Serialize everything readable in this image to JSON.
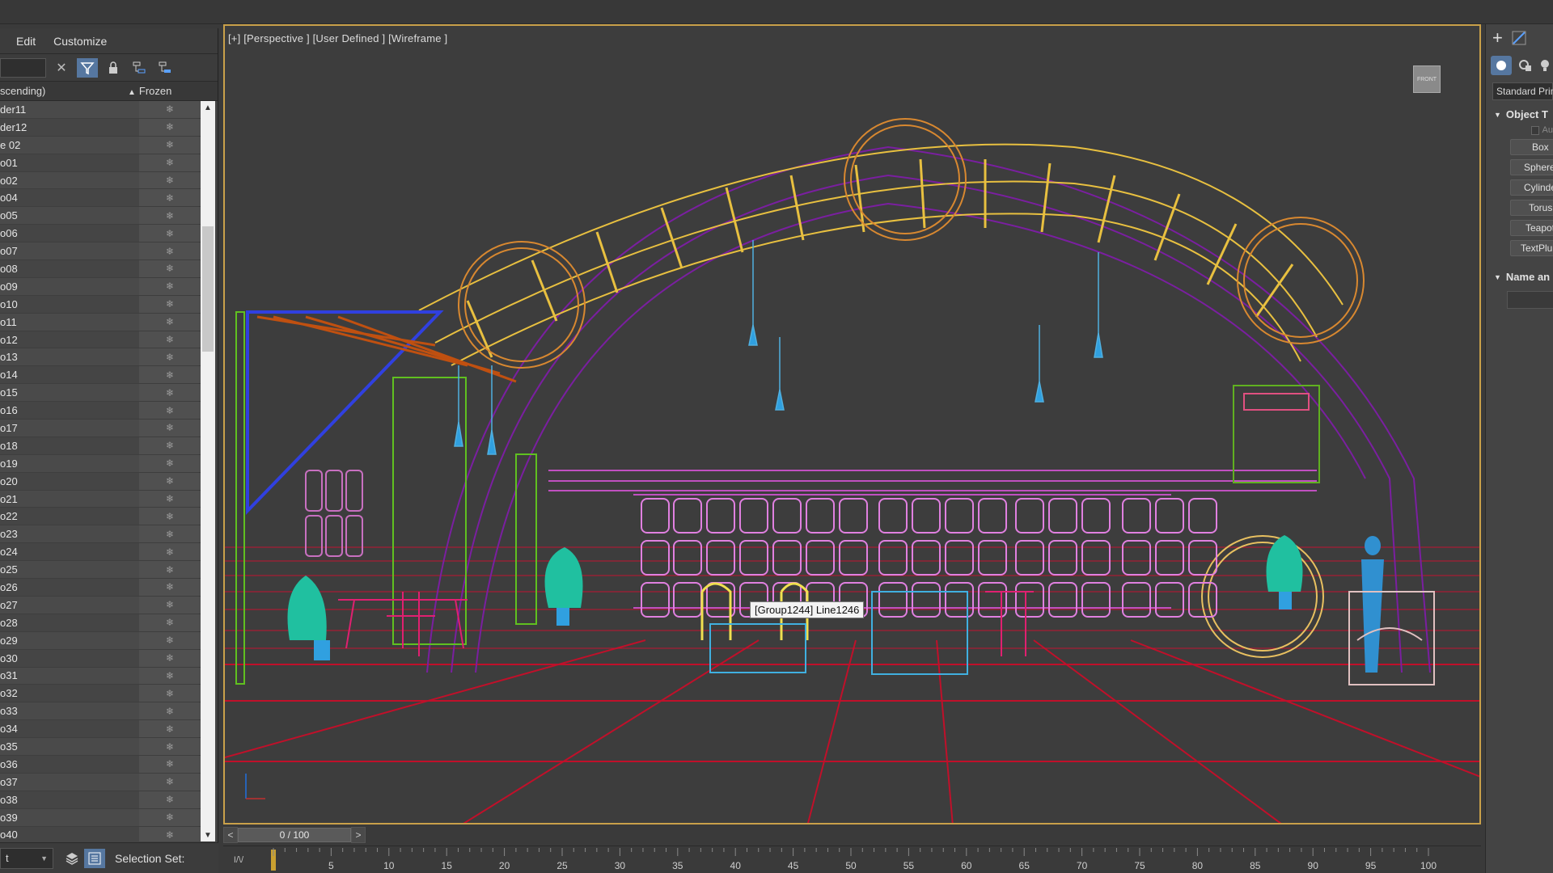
{
  "explorer": {
    "menu": [
      "Edit",
      "Customize"
    ],
    "header": {
      "name_col": "scending)",
      "sort_indicator": "▲",
      "frozen_col": "Frozen"
    },
    "rows": [
      "der11",
      "der12",
      "e 02",
      "o01",
      "o02",
      "o04",
      "o05",
      "o06",
      "o07",
      "o08",
      "o09",
      "o10",
      "o11",
      "o12",
      "o13",
      "o14",
      "o15",
      "o16",
      "o17",
      "o18",
      "o19",
      "o20",
      "o21",
      "o22",
      "o23",
      "o24",
      "o25",
      "o26",
      "o27",
      "o28",
      "o29",
      "o30",
      "o31",
      "o32",
      "o33",
      "o34",
      "o35",
      "o36",
      "o37",
      "o38",
      "o39",
      "o40"
    ],
    "frozen_icon": "snowflake-icon",
    "bottom": {
      "layer_value": "t",
      "selection_set_label": "Selection Set:"
    }
  },
  "viewport": {
    "label": "[+] [Perspective ] [User Defined ] [Wireframe ]",
    "viewcube_label": "FRONT",
    "tooltip": "[Group1244] Line1246"
  },
  "time_slider": {
    "prev": "<",
    "value": "0 / 100",
    "next": ">"
  },
  "trackbar": {
    "ticks": [
      "5",
      "10",
      "15",
      "20",
      "25",
      "30",
      "35",
      "40",
      "45",
      "50",
      "55",
      "60",
      "65",
      "70",
      "75",
      "80",
      "85",
      "90",
      "95",
      "100"
    ],
    "curve_label": "I/\\/"
  },
  "command_panel": {
    "category_dropdown": "Standard Prim",
    "rollout_object_type": "Object T",
    "autogrid_label": "Au",
    "buttons": [
      "Box",
      "Sphere",
      "Cylinde",
      "Torus",
      "Teapot",
      "TextPlu"
    ],
    "rollout_name": "Name an"
  },
  "colors": {
    "accent_border": "#c9a04a",
    "active_button": "#5677a0",
    "viewport_bg": "#3d3d3d"
  }
}
